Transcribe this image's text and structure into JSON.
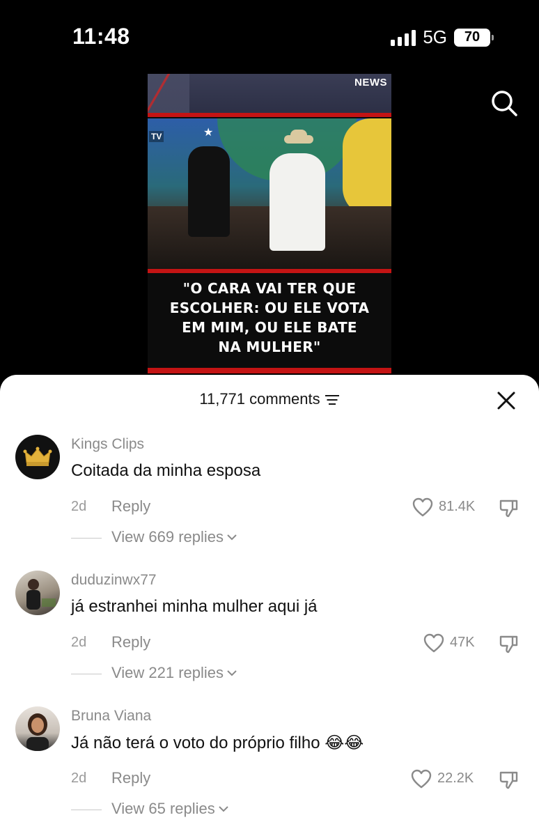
{
  "status_bar": {
    "time": "11:48",
    "network": "5G",
    "battery": "70"
  },
  "video": {
    "logo": "NEWS",
    "tv_tag": "TV",
    "quote": "\"O CARA VAI TER QUE\nESCOLHER: OU ELE VOTA\nEM MIM, OU ELE BATE\nNA MULHER\""
  },
  "comments_panel": {
    "count_label": "11,771 comments",
    "items": [
      {
        "username": "Kings Clips",
        "text": "Coitada da minha esposa",
        "time": "2d",
        "reply_label": "Reply",
        "likes": "81.4K",
        "view_replies": "View 669 replies",
        "avatar": "crown-icon"
      },
      {
        "username": "duduzinwx77",
        "text": "já estranhei minha mulher aqui já",
        "time": "2d",
        "reply_label": "Reply",
        "likes": "47K",
        "view_replies": "View 221 replies",
        "avatar": "user-photo"
      },
      {
        "username": "Bruna Viana",
        "text": "Já não terá o voto do próprio filho 😂😂",
        "time": "2d",
        "reply_label": "Reply",
        "likes": "22.2K",
        "view_replies": "View 65 replies",
        "avatar": "user-photo"
      }
    ]
  },
  "colors": {
    "background": "#000000",
    "sheet": "#ffffff",
    "muted_text": "#8a8a8a",
    "news_red": "#c41414"
  }
}
